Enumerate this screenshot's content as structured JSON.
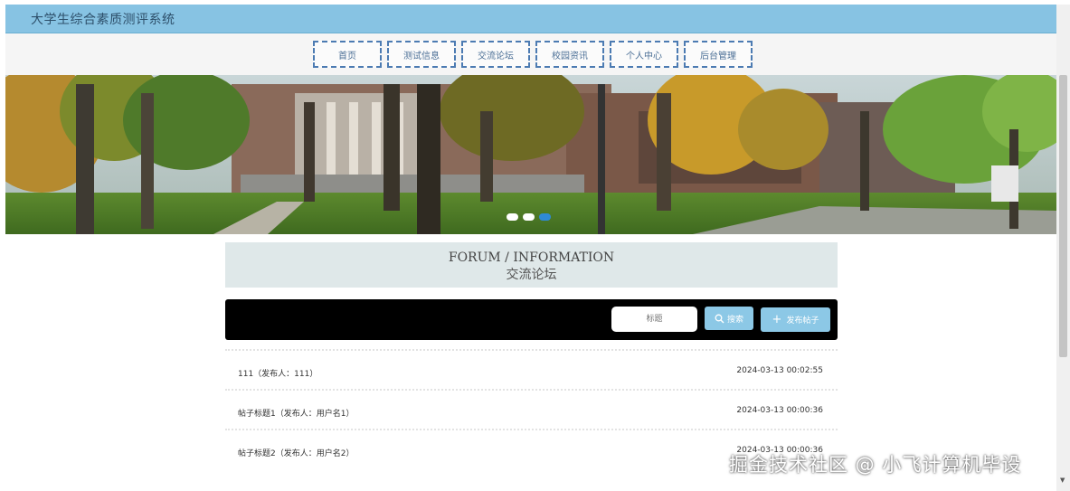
{
  "header": {
    "app_title": "大学生综合素质测评系统"
  },
  "nav": {
    "items": [
      {
        "label": "首页"
      },
      {
        "label": "测试信息"
      },
      {
        "label": "交流论坛"
      },
      {
        "label": "校园资讯"
      },
      {
        "label": "个人中心"
      },
      {
        "label": "后台管理"
      }
    ]
  },
  "banner": {
    "slide_count": 3,
    "active_slide": 3
  },
  "section": {
    "title_en": "FORUM / INFORMATION",
    "title_cn": "交流论坛"
  },
  "search": {
    "placeholder": "标题",
    "search_label": "搜索",
    "post_label": "发布帖子"
  },
  "posts": [
    {
      "title": "111（发布人：111）",
      "time": "2024-03-13 00:02:55"
    },
    {
      "title": "帖子标题1（发布人：用户名1）",
      "time": "2024-03-13 00:00:36"
    },
    {
      "title": "帖子标题2（发布人：用户名2）",
      "time": "2024-03-13 00:00:36"
    }
  ],
  "watermark": {
    "text": "掘金技术社区 @ 小飞计算机毕设"
  },
  "colors": {
    "title_bar": "#87c3e3",
    "nav_border": "#4c7bb2",
    "button": "#8cc8e6",
    "search_bar": "#000000",
    "heading_bg": "#dfe8e9",
    "active_dot": "#2f8ad6"
  },
  "icons": {
    "search": "magnifier-icon",
    "post": "plus-icon"
  }
}
